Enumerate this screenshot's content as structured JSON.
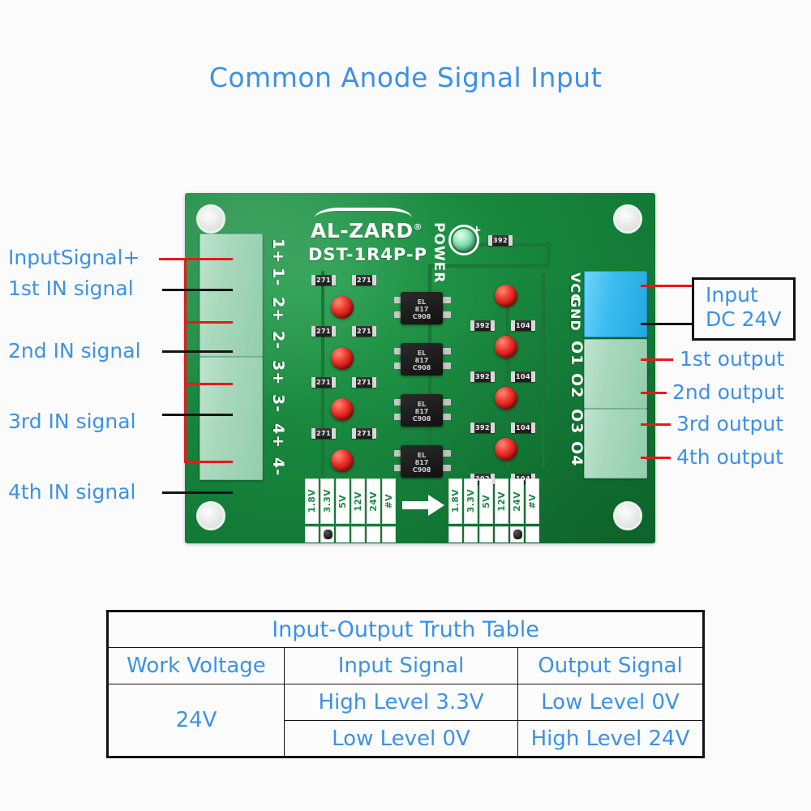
{
  "title": "Common Anode Signal Input",
  "board": {
    "brand": "AL-ZARD",
    "brand_reg": "®",
    "model": "DST-1R4P-P",
    "power_label": "POWER",
    "input_pin_labels": [
      "1+",
      "1-",
      "2+",
      "2-",
      "3+",
      "3-",
      "4+",
      "4-"
    ],
    "supply_pin_labels": [
      "GND",
      "VCC"
    ],
    "output_pin_labels": [
      "O1",
      "O2",
      "O3",
      "O4"
    ],
    "opto_part": {
      "line1": "EL",
      "line2": "817",
      "line3": "C908"
    },
    "input_resistors": [
      "271",
      "271"
    ],
    "output_resistors": [
      "392",
      "104"
    ],
    "power_resistor": "392",
    "voltage_selector_left": {
      "options": [
        "1.8V",
        "3.3V",
        "5V",
        "12V",
        "24V",
        "#V"
      ],
      "selected_index": 1
    },
    "voltage_selector_right": {
      "options": [
        "1.8V",
        "3.3V",
        "5V",
        "12V",
        "24V",
        "#V"
      ],
      "selected_index": 4
    }
  },
  "callouts": {
    "left": [
      "InputSignal+",
      "1st IN signal",
      "2nd IN signal",
      "3rd IN signal",
      "4th IN signal"
    ],
    "power_input": {
      "line1": "Input",
      "line2": "DC 24V"
    },
    "right_outputs": [
      "1st output",
      "2nd output",
      "3rd output",
      "4th output"
    ]
  },
  "truth_table": {
    "title": "Input-Output Truth Table",
    "headers": [
      "Work Voltage",
      "Input Signal",
      "Output Signal"
    ],
    "work_voltage": "24V",
    "rows": [
      {
        "input": "High Level 3.3V",
        "output": "Low Level 0V"
      },
      {
        "input": "Low Level 0V",
        "output": "High Level 24V"
      }
    ]
  },
  "colors": {
    "accent_blue": "#3c91e6",
    "line_red": "#e8181b",
    "line_black": "#151515",
    "pcb_green": "#17853c",
    "terminal_green": "#a9d9bd",
    "terminal_blue": "#3cbdf0"
  }
}
